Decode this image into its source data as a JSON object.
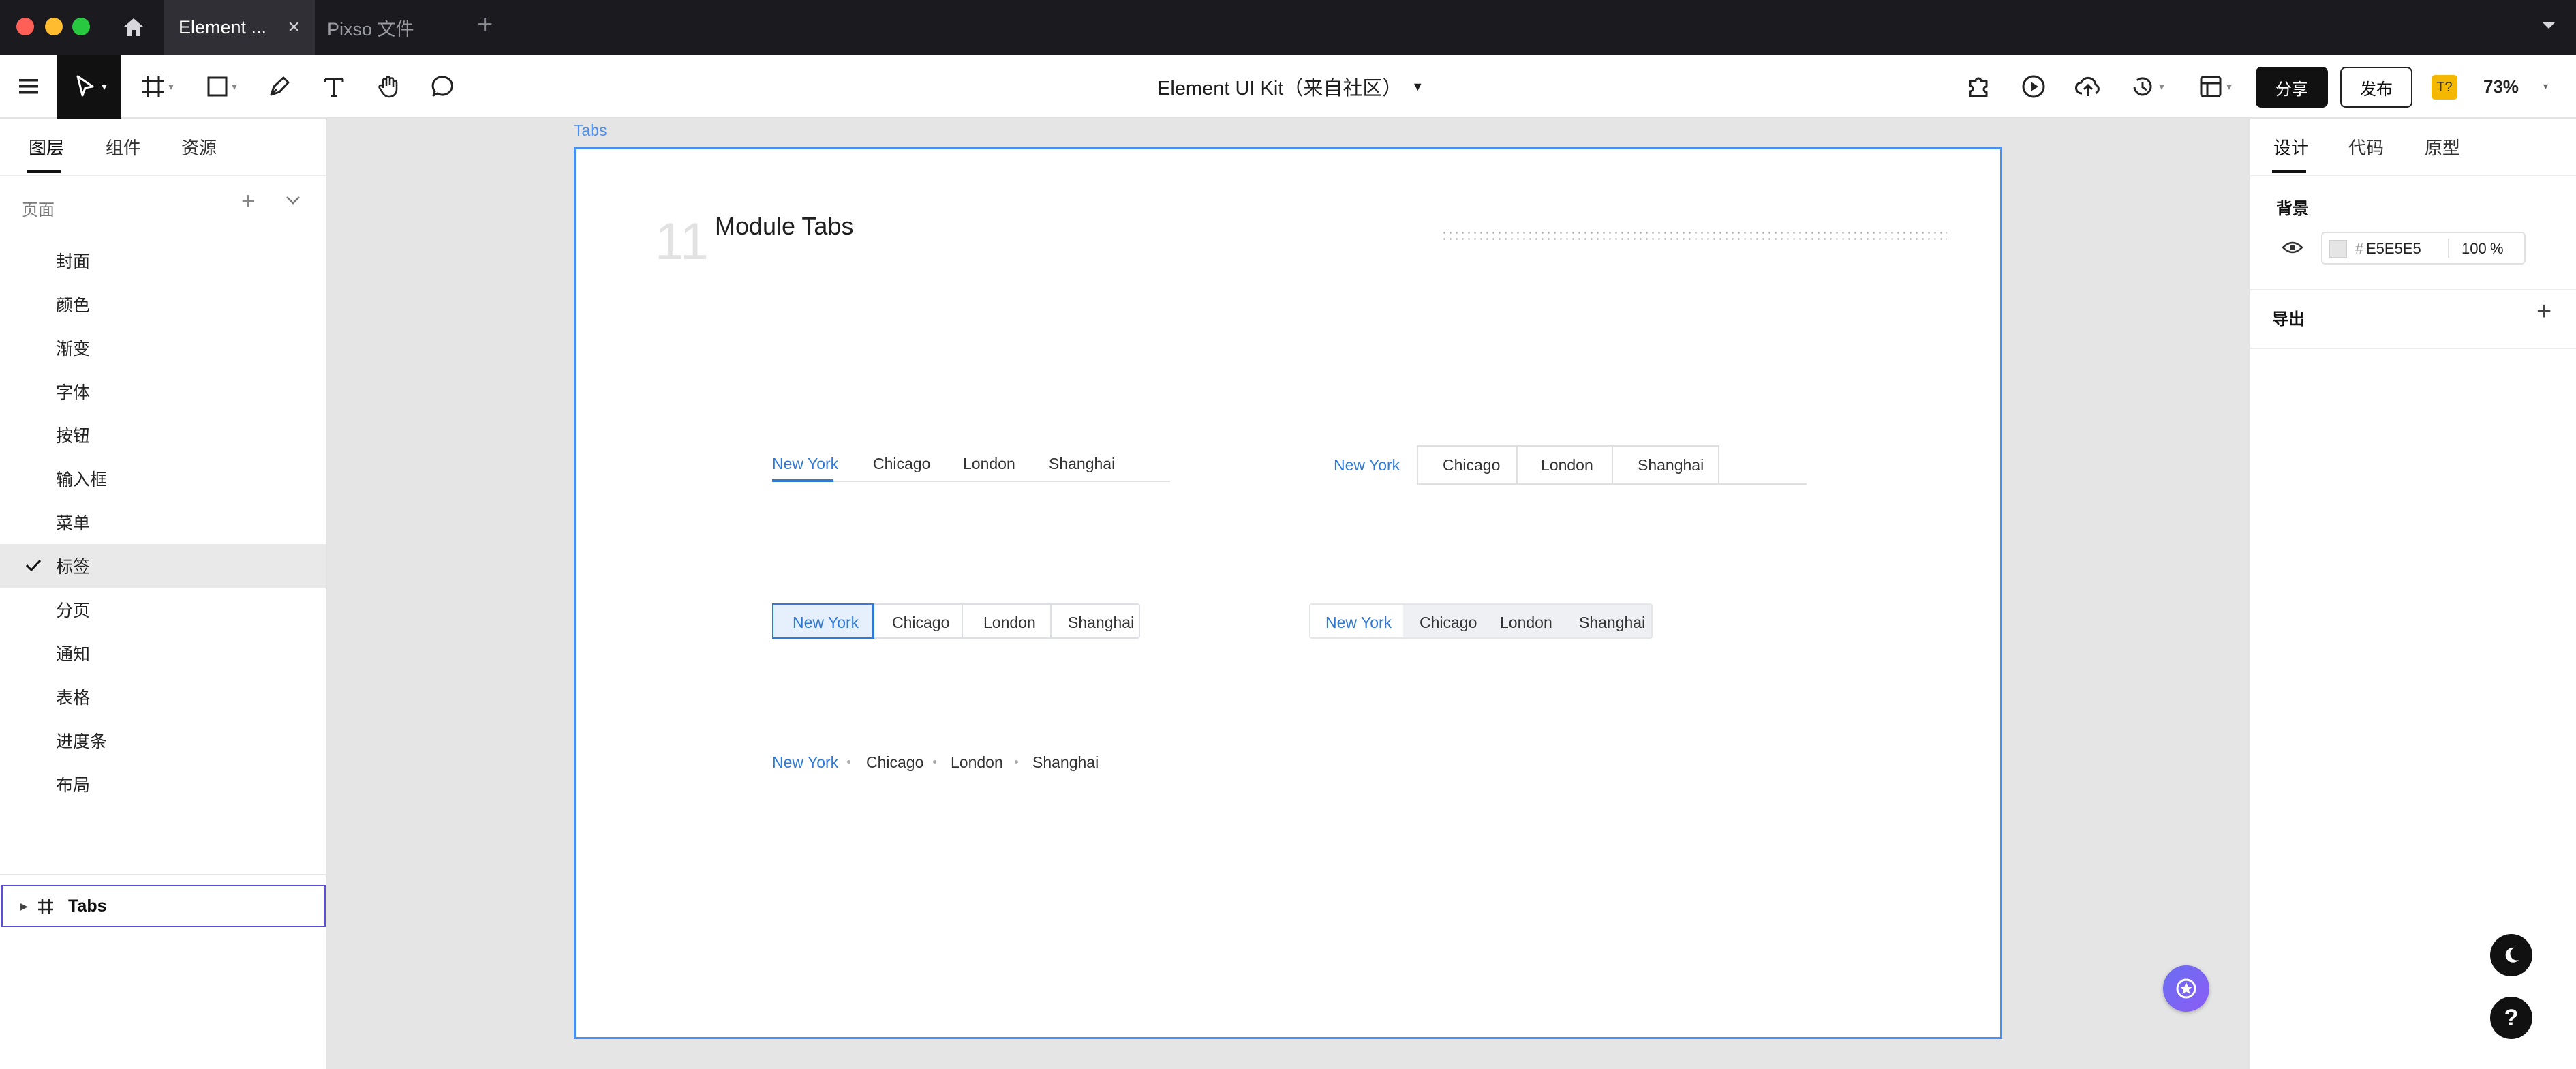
{
  "titlebar": {
    "tabs": [
      {
        "label": "Element ..."
      },
      {
        "label": "Pixso 文件"
      }
    ],
    "add_tab": "+"
  },
  "toolbar": {
    "doc_title": "Element UI Kit（来自社区）",
    "share_label": "分享",
    "publish_label": "发布",
    "font_badge": "T?",
    "zoom": "73%"
  },
  "left_panel": {
    "tabs": [
      "图层",
      "组件",
      "资源"
    ],
    "pages_label": "页面",
    "pages": [
      "封面",
      "颜色",
      "渐变",
      "字体",
      "按钮",
      "输入框",
      "菜单",
      "标签",
      "分页",
      "通知",
      "表格",
      "进度条",
      "布局"
    ],
    "selected_page_index": 7,
    "layer": {
      "label": "Tabs"
    }
  },
  "right_panel": {
    "tabs": [
      "设计",
      "代码",
      "原型"
    ],
    "background_label": "背景",
    "bg_color_hash": "#",
    "bg_color": "E5E5E5",
    "bg_opacity": "100",
    "bg_opacity_unit": "%",
    "export_label": "导出"
  },
  "canvas": {
    "frame_label": "Tabs",
    "section_number": "11",
    "section_title": "Module Tabs",
    "tabs_labels": [
      "New York",
      "Chicago",
      "London",
      "Shanghai"
    ]
  },
  "colors": {
    "accent": "#2f7ad8",
    "frame_border": "#4a8ef0",
    "canvas_bg": "#E5E5E5"
  }
}
